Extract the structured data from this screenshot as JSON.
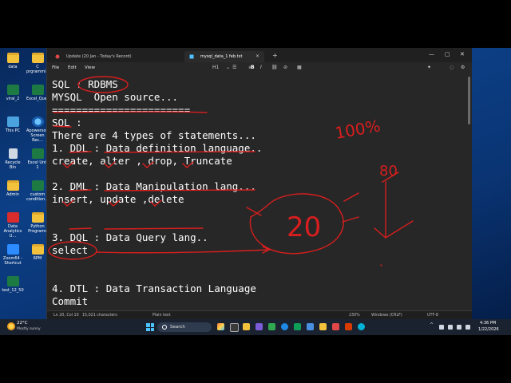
{
  "desktop": {
    "icons": [
      {
        "label": "data",
        "icon": "folder-icon"
      },
      {
        "label": "C\nprgrammi...",
        "icon": "folder-icon"
      },
      {
        "label": "viral_2",
        "icon": "excel-icon"
      },
      {
        "label": "Excel_Ques...",
        "icon": "excel-icon"
      },
      {
        "label": "This PC",
        "icon": "computer-icon"
      },
      {
        "label": "Apowersoft\nScreen Rec...",
        "icon": "screen-recorder-icon"
      },
      {
        "label": "Recycle Bin",
        "icon": "recycle-bin-icon"
      },
      {
        "label": "Excel Unit 1",
        "icon": "excel-icon"
      },
      {
        "label": "Admin",
        "icon": "folder-icon"
      },
      {
        "label": "custom\ncondition...",
        "icon": "excel-icon"
      },
      {
        "label": "Data\nAnalytics U...",
        "icon": "pdf-icon"
      },
      {
        "label": "Python\nPrograms",
        "icon": "folder-icon"
      },
      {
        "label": "Zoom64 -\nShortcut",
        "icon": "zoom-icon"
      },
      {
        "label": "6PM",
        "icon": "folder-icon"
      },
      {
        "label": "test_12_50",
        "icon": "excel-icon"
      }
    ]
  },
  "window": {
    "tabs": [
      {
        "label": "Update (20 Jan - Today's Record)"
      },
      {
        "label": "mysql_data_1 feb.txt"
      }
    ],
    "menu": [
      "File",
      "Edit",
      "View"
    ],
    "toolbar": {
      "heading": "H1",
      "bold": "B",
      "italic": "I"
    },
    "editor_lines": [
      "SQL : RDBMS",
      "MYSQL  Open source...",
      "=======================",
      "SQL :",
      "There are 4 types of statements...",
      "1. DDL : Data definition language..",
      "create, alter , drop, Truncate",
      "",
      "2. DML : Data Manipulation lang...",
      "insert, update ,delete",
      "",
      "",
      "3. DQL : Data Query lang..",
      "select",
      "",
      "",
      "4. DTL : Data Transaction Language",
      "Commit"
    ],
    "annotations": {
      "pct": "100%",
      "circle_num": "20",
      "arrow_num": "80"
    },
    "status": {
      "position": "Ln 20, Col 10",
      "chars": "15,021 characters",
      "format": "Plain text",
      "zoom": "230%",
      "line_ending": "Windows (CRLF)",
      "encoding": "UTF-8"
    }
  },
  "taskbar": {
    "weather_temp": "22°C",
    "weather_desc": "Mostly sunny",
    "search_placeholder": "Search",
    "time": "4:36 PM",
    "date": "1/22/2026"
  },
  "colors": {
    "desktop_bg": "#0c3f86",
    "editor_bg": "#272727",
    "text": "#ffffff",
    "ink": "#d81e1e"
  }
}
